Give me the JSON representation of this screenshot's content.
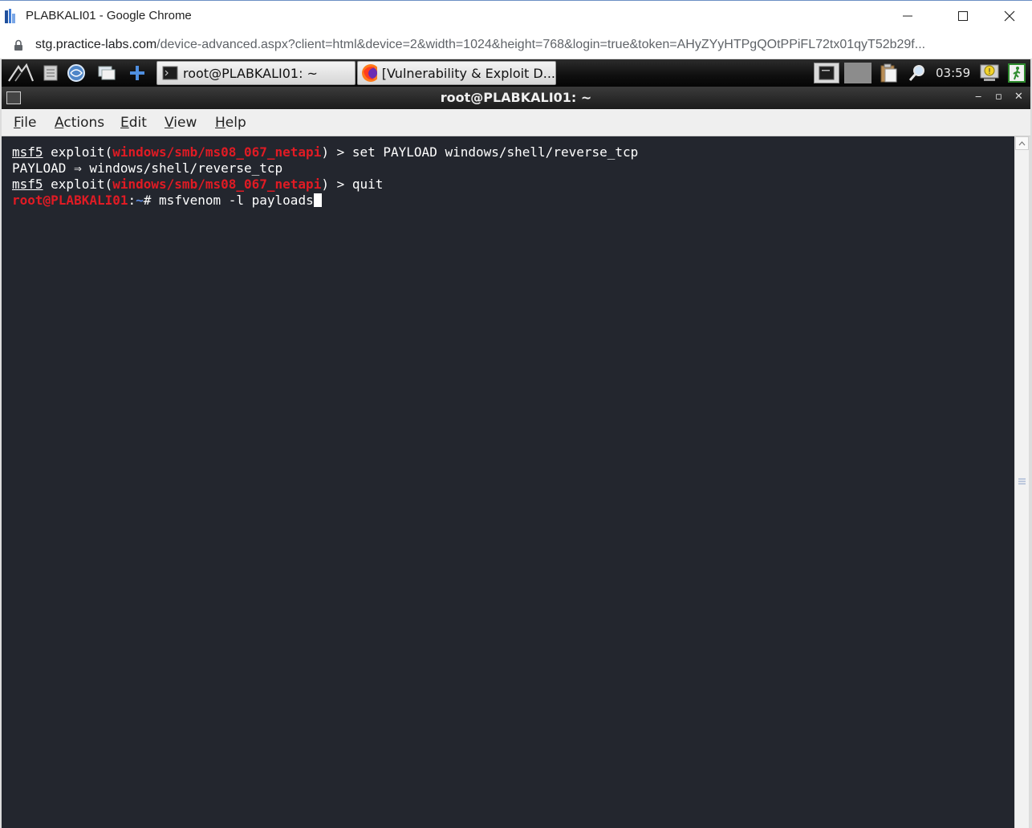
{
  "browser": {
    "window_title": "PLABKALI01 - Google Chrome",
    "url_host": "stg.practice-labs.com",
    "url_rest": "/device-advanced.aspx?client=html&device=2&width=1024&height=768&login=true&token=AHyZYyHTPgQOtPPiFL72tx01qyT52b29f..."
  },
  "panel": {
    "tasks": [
      {
        "label": "root@PLABKALI01: ~",
        "icon": "terminal-icon"
      },
      {
        "label": "[Vulnerability & Exploit D...",
        "icon": "firefox-icon"
      }
    ],
    "clock": "03:59",
    "tray_icons": [
      "terminal-tray-icon",
      "workspace-icon",
      "clipboard-icon",
      "search-icon",
      "update-notifier-icon",
      "logout-icon"
    ]
  },
  "terminal": {
    "title": "root@PLABKALI01: ~",
    "menu": [
      "File",
      "Actions",
      "Edit",
      "View",
      "Help"
    ],
    "lines": [
      {
        "prompt": "msf5",
        "mid": " exploit(",
        "module": "windows/smb/ms08_067_netapi",
        "tail": ") > set PAYLOAD windows/shell/reverse_tcp"
      },
      {
        "text": "PAYLOAD ⇒ windows/shell/reverse_tcp"
      },
      {
        "prompt": "msf5",
        "mid": " exploit(",
        "module": "windows/smb/ms08_067_netapi",
        "tail": ") > quit"
      },
      {
        "user": "root@PLABKALI01",
        "sep": ":",
        "path": "~",
        "cmd": "# msfvenom -l payloads"
      }
    ]
  },
  "colors": {
    "terminal_bg": "#23262e",
    "module_red": "#e01b24",
    "path_blue": "#5d8be0"
  }
}
